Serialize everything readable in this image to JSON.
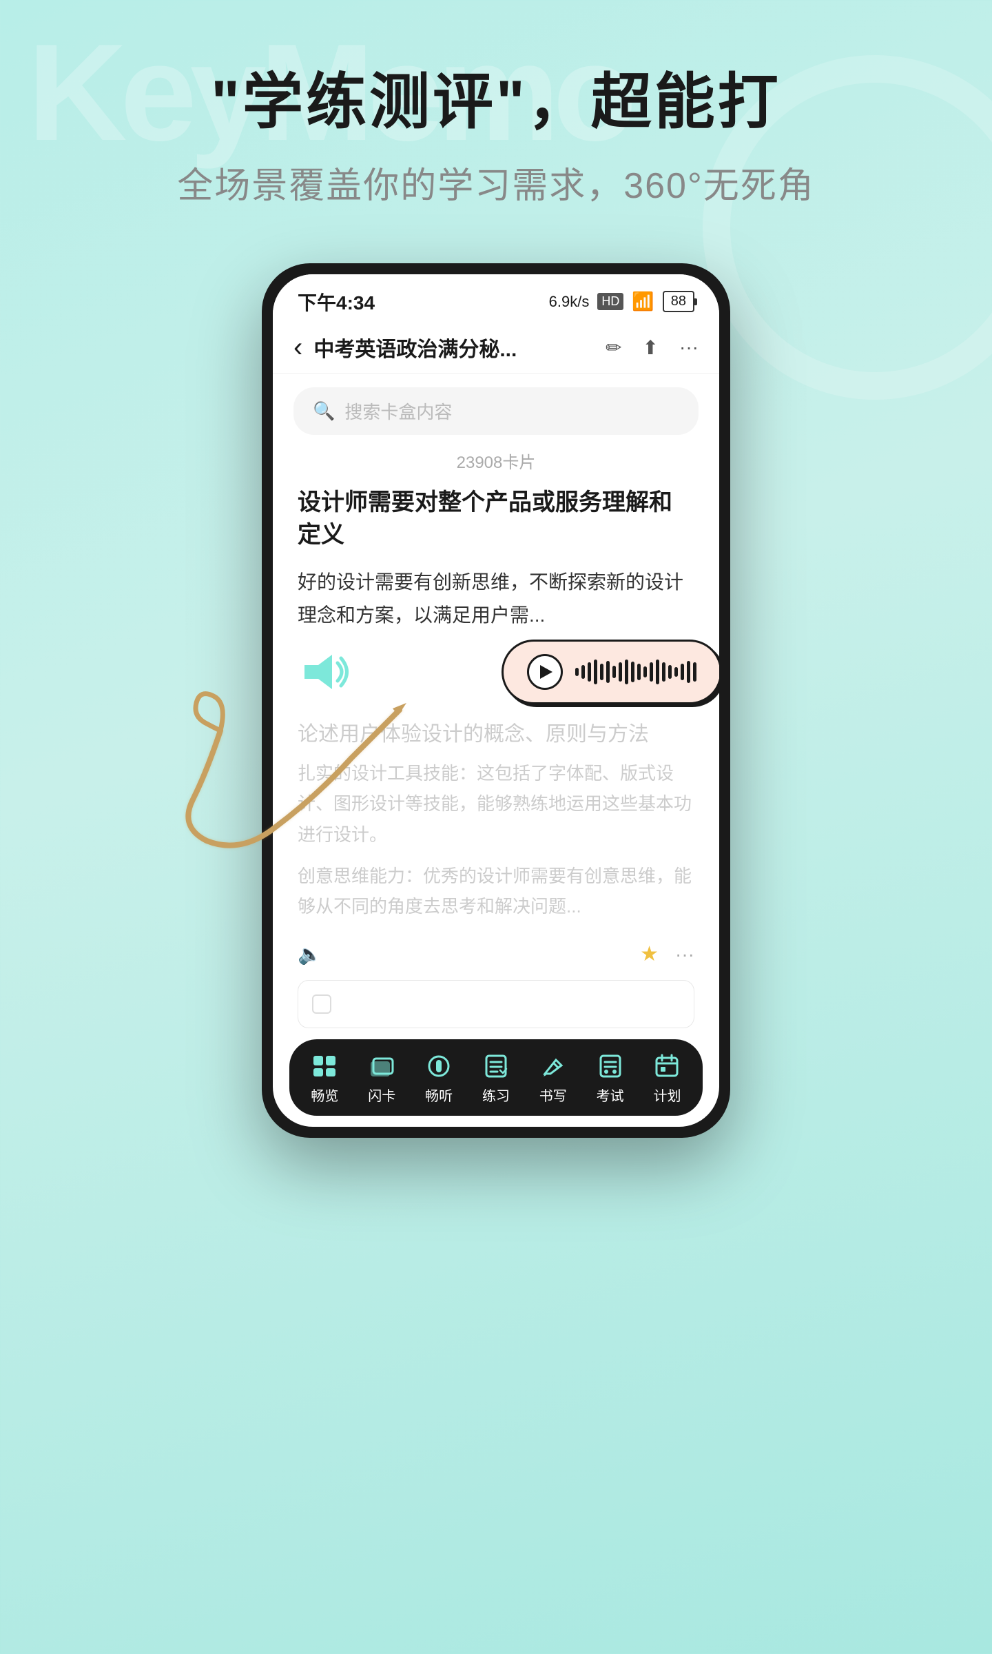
{
  "background": {
    "bg_text": "KeyMemo",
    "colors": {
      "primary_bg": "#b8eee8",
      "phone_bg": "#1a1a1a",
      "card_bg": "#ffffff",
      "accent": "#7de8da",
      "audio_bg": "#fde8e0"
    }
  },
  "header": {
    "main_title": "\"学练测评\"，超能打",
    "sub_title": "全场景覆盖你的学习需求，360°无死角"
  },
  "phone": {
    "status_bar": {
      "time": "下午4:34",
      "speed": "6.9k/s",
      "hd_label": "HD",
      "signal": "📶",
      "battery": "88"
    },
    "nav": {
      "back_label": "‹",
      "title": "中考英语政治满分秘...",
      "edit_icon": "✏",
      "share_icon": "⬆",
      "more_icon": "···"
    },
    "search": {
      "placeholder": "搜索卡盒内容"
    },
    "card_count": "23908卡片",
    "card": {
      "title": "设计师需要对整个产品或服务理解和定义",
      "body": "好的设计需要有创新思维，不断探索新的设计理念和方案，以满足用户需...",
      "blurred_title": "论述用户体验设计的概念、原则与方法",
      "blurred_body1": "扎实的设计工具技能：这包括了字体配、版式设计、图形设计等技能，能够熟练地运用这些基本功进行设计。",
      "blurred_body2": "创意思维能力：优秀的设计师需要有创意思维，能够从不同的角度去思考和解决问题..."
    },
    "audio_player": {
      "waveform_heights": [
        12,
        20,
        28,
        36,
        24,
        32,
        18,
        28,
        36,
        30,
        24,
        16,
        28,
        36,
        28,
        20,
        14,
        24,
        32,
        28
      ]
    },
    "bottom_nav": {
      "items": [
        {
          "icon": "📖",
          "label": "畅览"
        },
        {
          "icon": "🃏",
          "label": "闪卡"
        },
        {
          "icon": "🎵",
          "label": "畅听"
        },
        {
          "icon": "📝",
          "label": "练习"
        },
        {
          "icon": "✏️",
          "label": "书写"
        },
        {
          "icon": "📋",
          "label": "考试"
        },
        {
          "icon": "📅",
          "label": "计划"
        }
      ]
    }
  }
}
